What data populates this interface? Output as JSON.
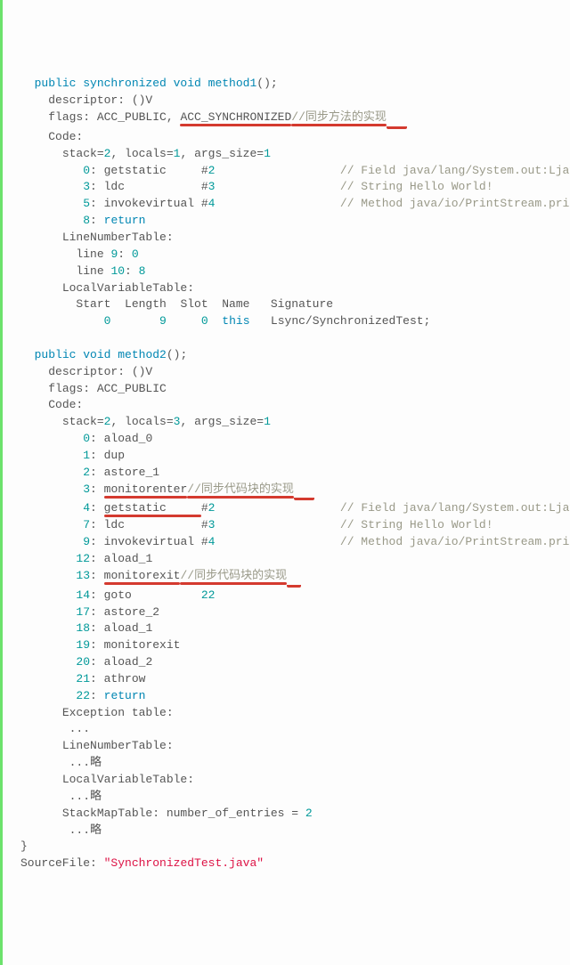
{
  "m1": {
    "sig_pre": "public synchronized void ",
    "name": "method1",
    "sig_post": "();",
    "descriptor": "descriptor: ()V",
    "flags_pre": "flags: ACC_PUBLIC, ",
    "flags_hl": "ACC_SYNCHRONIZED",
    "flags_comment": "//同步方法的实现",
    "code_label": "Code:",
    "stack": "stack=",
    "stack_v": "2",
    "locals": ", locals=",
    "locals_v": "1",
    "args": ", args_size=",
    "args_v": "1",
    "i0_off": "0",
    "i0_op": ": getstatic     #",
    "i0_ref": "2",
    "i0_c": "// Field java/lang/System.out:Ljava/io",
    "i1_off": "3",
    "i1_op": ": ldc           #",
    "i1_ref": "3",
    "i1_c": "// String Hello World!",
    "i2_off": "5",
    "i2_op": ": invokevirtual #",
    "i2_ref": "4",
    "i2_c": "// Method java/io/PrintStream.println:",
    "i3_off": "8",
    "i3_op": ": ",
    "i3_return": "return",
    "lnt": "LineNumberTable:",
    "lnt1": "line ",
    "lnt1a": "9",
    "lnt1b": ": ",
    "lnt1c": "0",
    "lnt2a": "10",
    "lnt2c": "8",
    "lvt": "LocalVariableTable:",
    "lvt_h": "Start  Length  Slot  Name   Signature",
    "lvt_r0a": "0",
    "lvt_r0b": "9",
    "lvt_r0c": "0",
    "lvt_r0d": "this",
    "lvt_r0e": "   Lsync/SynchronizedTest;"
  },
  "m2": {
    "sig_pre": "public void ",
    "name": "method2",
    "sig_post": "();",
    "descriptor": "descriptor: ()V",
    "flags": "flags: ACC_PUBLIC",
    "code_label": "Code:",
    "stack": "stack=",
    "stack_v": "2",
    "locals": ", locals=",
    "locals_v": "3",
    "args": ", args_size=",
    "args_v": "1",
    "l0": "0",
    "l0op": ": aload_0",
    "l1": "1",
    "l1op": ": dup",
    "l2": "2",
    "l2op": ": astore_1",
    "l3": "3",
    "l3op": ": ",
    "l3kw": "monitorenter",
    "l3c": "//同步代码块的实现",
    "l4": "4",
    "l4op": ": ",
    "l4a": "getstatic     ",
    "l4ref": "#",
    "l4refn": "2",
    "l4c": "// Field java/lang/System.out:Ljava/io",
    "l7": "7",
    "l7op": ": ldc           #",
    "l7refn": "3",
    "l7c": "// String Hello World!",
    "l9": "9",
    "l9op": ": invokevirtual #",
    "l9refn": "4",
    "l9c": "// Method java/io/PrintStream.println:",
    "l12": "12",
    "l12op": ": aload_1",
    "l13": "13",
    "l13op": ": ",
    "l13kw": "monitorexit",
    "l13c": "//同步代码块的实现",
    "l14": "14",
    "l14op": ": goto          ",
    "l14t": "22",
    "l17": "17",
    "l17op": ": astore_2",
    "l18": "18",
    "l18op": ": aload_1",
    "l19": "19",
    "l19op": ": monitorexit",
    "l20": "20",
    "l20op": ": aload_2",
    "l21": "21",
    "l21op": ": athrow",
    "l22": "22",
    "l22op": ": ",
    "l22kw": "return",
    "exc": "Exception table:",
    "ell": "...",
    "lnt": "LineNumberTable:",
    "omit": "...略",
    "lvt": "LocalVariableTable:",
    "smt": "StackMapTable: number_of_entries = ",
    "smt_n": "2"
  },
  "end": {
    "brace": "}",
    "src_pre": "SourceFile: ",
    "src": "\"SynchronizedTest.java\""
  }
}
